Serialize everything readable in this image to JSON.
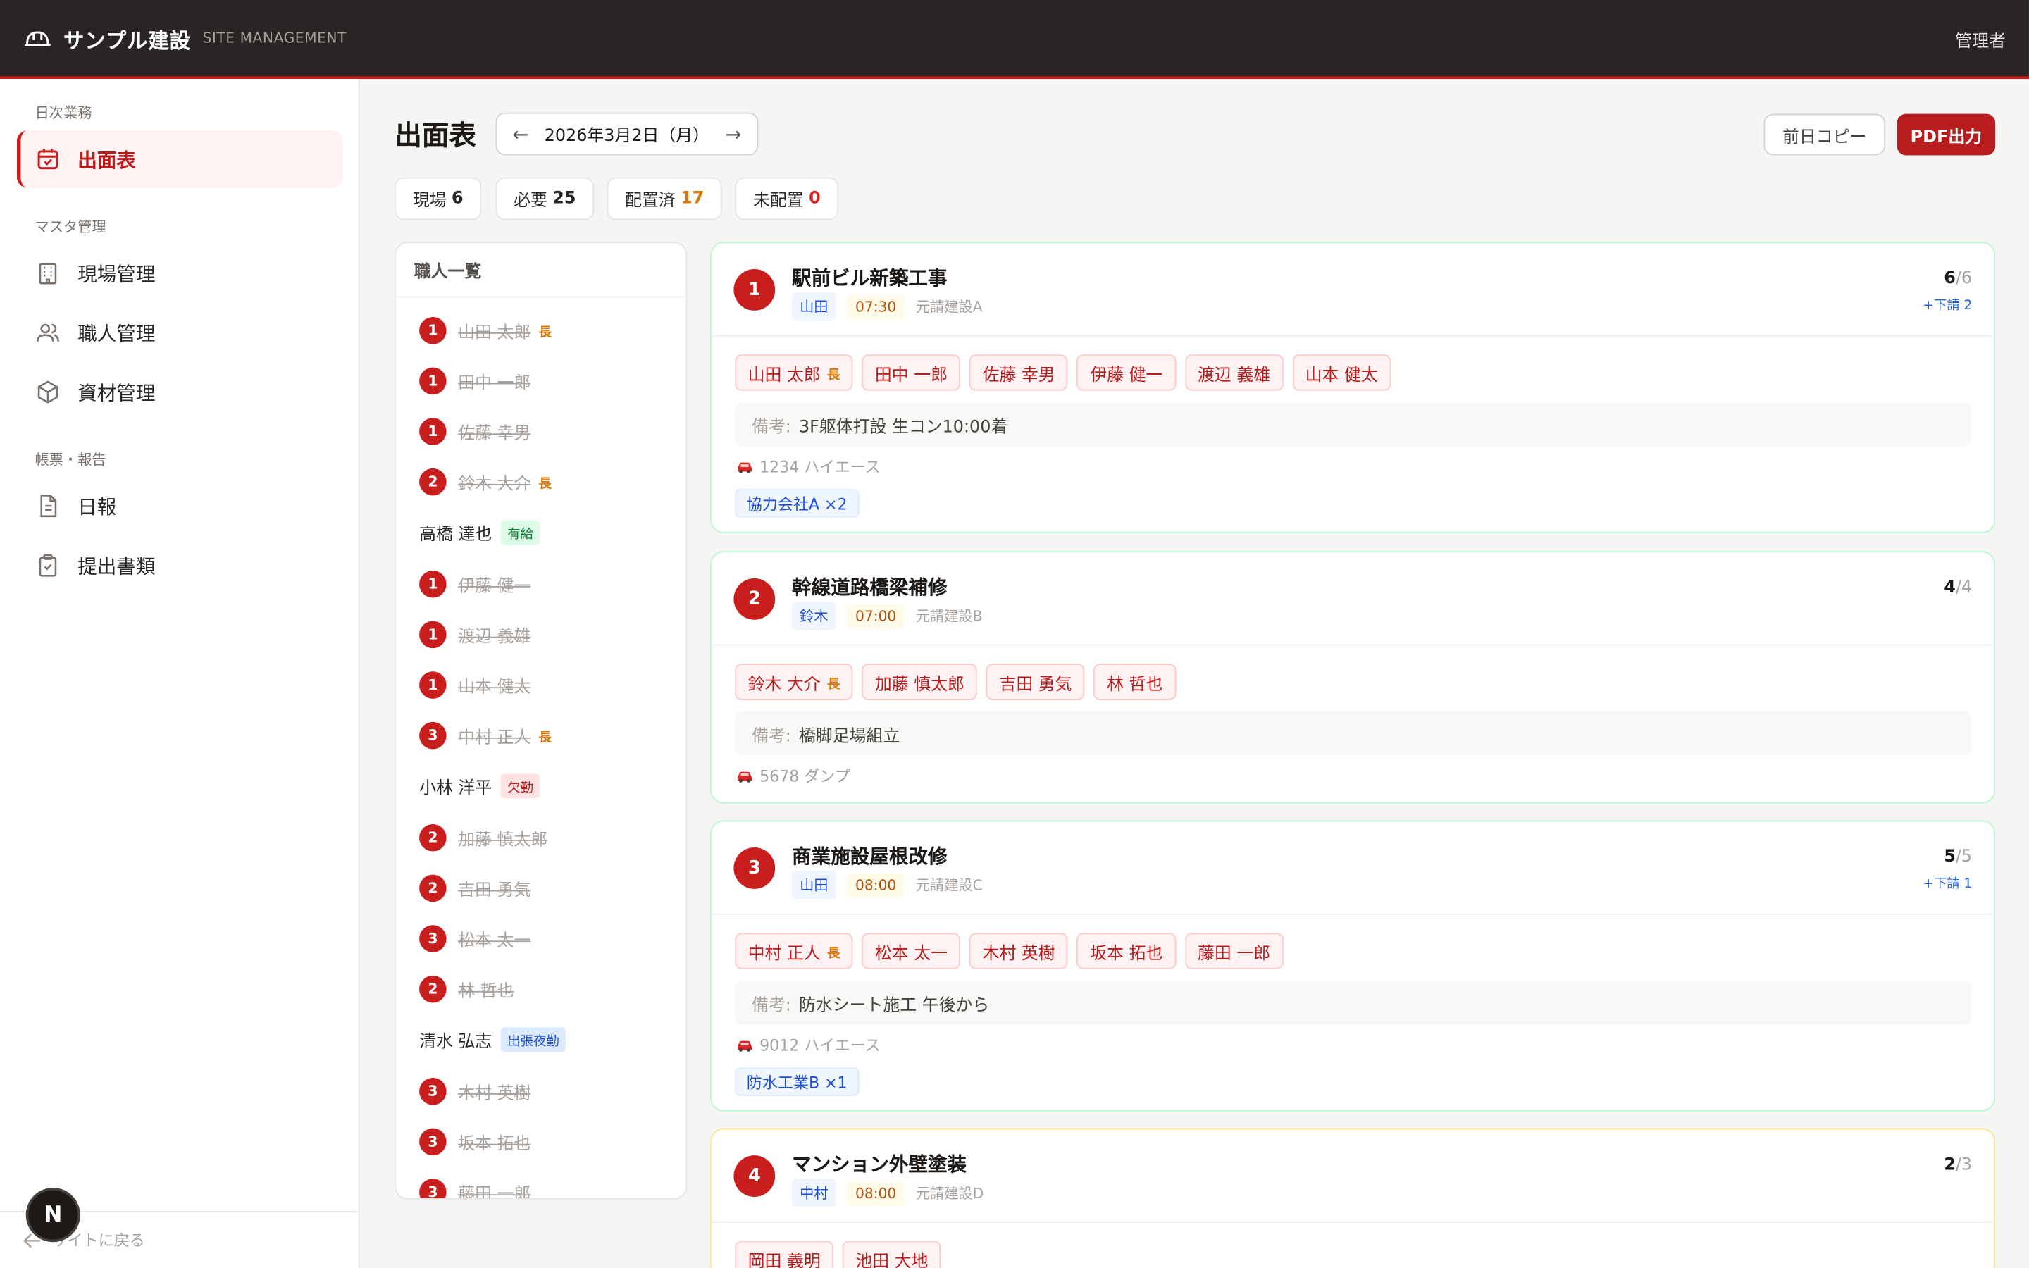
{
  "header": {
    "brand": "サンプル建設",
    "brand_sub": "SITE MANAGEMENT",
    "user": "管理者"
  },
  "sidebar": {
    "sections": [
      {
        "label": "日次業務",
        "items": [
          {
            "label": "出面表",
            "icon": "calendar-check-icon",
            "active": true
          }
        ]
      },
      {
        "label": "マスタ管理",
        "items": [
          {
            "label": "現場管理",
            "icon": "building-icon"
          },
          {
            "label": "職人管理",
            "icon": "users-icon"
          },
          {
            "label": "資材管理",
            "icon": "box-icon"
          }
        ]
      },
      {
        "label": "帳票・報告",
        "items": [
          {
            "label": "日報",
            "icon": "document-icon"
          },
          {
            "label": "提出書類",
            "icon": "clipboard-check-icon"
          }
        ]
      }
    ],
    "back_link": "サイトに戻る"
  },
  "page": {
    "title": "出面表",
    "date": "2026年3月2日（月）",
    "copy_button": "前日コピー",
    "pdf_button": "PDF出力"
  },
  "stats": [
    {
      "label": "現場",
      "value": "6",
      "color": "#1c1917"
    },
    {
      "label": "必要",
      "value": "25",
      "color": "#1c1917"
    },
    {
      "label": "配置済",
      "value": "17",
      "color": "#d97706"
    },
    {
      "label": "未配置",
      "value": "0",
      "color": "#dc2626"
    }
  ],
  "workers": {
    "title": "職人一覧",
    "items": [
      {
        "num": "1",
        "name": "山田 太郎",
        "chief": "長",
        "assigned": true
      },
      {
        "num": "1",
        "name": "田中 一郎",
        "assigned": true
      },
      {
        "num": "1",
        "name": "佐藤 幸男",
        "assigned": true
      },
      {
        "num": "2",
        "name": "鈴木 大介",
        "chief": "長",
        "assigned": true
      },
      {
        "name": "高橋 達也",
        "tag": "有給",
        "tag_bg": "#dcfce7",
        "tag_fg": "#15803d",
        "assigned": false
      },
      {
        "num": "1",
        "name": "伊藤 健一",
        "assigned": true
      },
      {
        "num": "1",
        "name": "渡辺 義雄",
        "assigned": true
      },
      {
        "num": "1",
        "name": "山本 健太",
        "assigned": true
      },
      {
        "num": "3",
        "name": "中村 正人",
        "chief": "長",
        "assigned": true
      },
      {
        "name": "小林 洋平",
        "tag": "欠勤",
        "tag_bg": "#fee2e2",
        "tag_fg": "#b91c1c",
        "assigned": false
      },
      {
        "num": "2",
        "name": "加藤 慎太郎",
        "assigned": true
      },
      {
        "num": "2",
        "name": "吉田 勇気",
        "assigned": true
      },
      {
        "num": "3",
        "name": "松本 太一",
        "assigned": true
      },
      {
        "num": "2",
        "name": "林 哲也",
        "assigned": true
      },
      {
        "name": "清水 弘志",
        "tag": "出張夜勤",
        "tag_bg": "#dbeafe",
        "tag_fg": "#1d4ed8",
        "assigned": false
      },
      {
        "num": "3",
        "name": "木村 英樹",
        "assigned": true
      },
      {
        "num": "3",
        "name": "坂本 拓也",
        "assigned": true
      },
      {
        "num": "3",
        "name": "藤田 一郎",
        "assigned": true
      }
    ]
  },
  "sites": [
    {
      "num": "1",
      "name": "駅前ビル新築工事",
      "lead": "山田",
      "time": "07:30",
      "gc": "元請建設A",
      "assigned": "6",
      "required": "/6",
      "sub": "+下請 2",
      "chips": [
        {
          "name": "山田 太郎",
          "chief": "長"
        },
        {
          "name": "田中 一郎"
        },
        {
          "name": "佐藤 幸男"
        },
        {
          "name": "伊藤 健一"
        },
        {
          "name": "渡辺 義雄"
        },
        {
          "name": "山本 健太"
        }
      ],
      "note_label": "備考:",
      "note": "3F躯体打設 生コン10:00着",
      "vehicle": "1234 ハイエース",
      "partner": "協力会社A ×2",
      "status": "ok"
    },
    {
      "num": "2",
      "name": "幹線道路橋梁補修",
      "lead": "鈴木",
      "time": "07:00",
      "gc": "元請建設B",
      "assigned": "4",
      "required": "/4",
      "chips": [
        {
          "name": "鈴木 大介",
          "chief": "長"
        },
        {
          "name": "加藤 慎太郎"
        },
        {
          "name": "吉田 勇気"
        },
        {
          "name": "林 哲也"
        }
      ],
      "note_label": "備考:",
      "note": "橋脚足場組立",
      "vehicle": "5678 ダンプ",
      "status": "ok"
    },
    {
      "num": "3",
      "name": "商業施設屋根改修",
      "lead": "山田",
      "time": "08:00",
      "gc": "元請建設C",
      "assigned": "5",
      "required": "/5",
      "sub": "+下請 1",
      "chips": [
        {
          "name": "中村 正人",
          "chief": "長"
        },
        {
          "name": "松本 太一"
        },
        {
          "name": "木村 英樹"
        },
        {
          "name": "坂本 拓也"
        },
        {
          "name": "藤田 一郎"
        }
      ],
      "note_label": "備考:",
      "note": "防水シート施工 午後から",
      "vehicle": "9012 ハイエース",
      "partner": "防水工業B ×1",
      "status": "ok"
    },
    {
      "num": "4",
      "name": "マンション外壁塗装",
      "lead": "中村",
      "time": "08:00",
      "gc": "元請建設D",
      "assigned": "2",
      "required": "/3",
      "chips": [
        {
          "name": "岡田 義明"
        },
        {
          "name": "池田 大地"
        }
      ],
      "status": "warn"
    }
  ],
  "fab_label": "N"
}
